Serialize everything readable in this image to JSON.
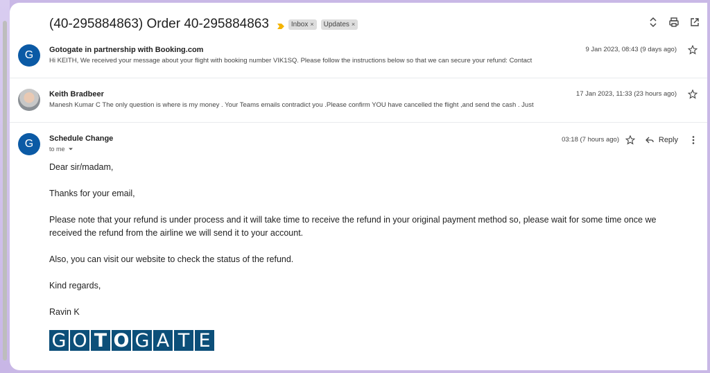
{
  "thread": {
    "subject": "(40-295884863) Order 40-295884863",
    "labels": [
      {
        "name": "Inbox",
        "remove": "×"
      },
      {
        "name": "Updates",
        "remove": "×"
      }
    ],
    "icons": [
      "expand-collapse-icon",
      "print-icon",
      "open-in-new-window-icon"
    ]
  },
  "messages": [
    {
      "avatar_letter": "G",
      "sender": "Gotogate in partnership with Booking.com",
      "date": "9 Jan 2023, 08:43 (9 days ago)",
      "snippet": "Hi KEITH, We received your message about your flight with booking number VIK1SQ. Please follow the instructions below so that we can secure your refund: Contact"
    },
    {
      "avatar_letter": "",
      "sender": "Keith Bradbeer",
      "date": "17 Jan 2023, 11:33 (23 hours ago)",
      "snippet": "Manesh Kumar C The only question is where is my money . Your Teams emails contradict you .Please confirm YOU have cancelled the flight ,and send the cash . Just"
    },
    {
      "avatar_letter": "G",
      "sender": "Schedule Change",
      "date": "03:18 (7 hours ago)",
      "recipient": "to me",
      "reply_label": "Reply",
      "body": [
        "Dear sir/madam,",
        "Thanks for your email,",
        "Please note that your refund is under process and it will take time to receive the refund in your original payment method so, please wait for some time once we received the refund from the airline we will send it to your account.",
        "Also, you can visit our website to check the status of the refund.",
        "Kind regards,",
        "Ravin K"
      ],
      "logo_letters": [
        "G",
        "O",
        "T",
        "O",
        "G",
        "A",
        "T",
        "E"
      ]
    }
  ],
  "colors": {
    "avatar": "#0b5aa5",
    "logo": "#0c4f79",
    "importance": "#f4b400",
    "background": "#c9b8e6"
  }
}
